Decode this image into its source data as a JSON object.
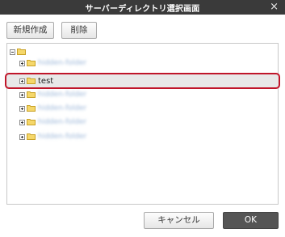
{
  "dialog": {
    "title": "サーバーディレクトリ選択画面",
    "close_glyph": "×"
  },
  "toolbar": {
    "new_label": "新規作成",
    "delete_label": "削除"
  },
  "tree": {
    "root_name": "",
    "items": [
      {
        "label": "hidden-folder",
        "blurred": true,
        "selected": false
      },
      {
        "label": "test",
        "blurred": false,
        "selected": true
      },
      {
        "label": "hidden-folder",
        "blurred": true,
        "selected": false
      },
      {
        "label": "hidden-folder",
        "blurred": true,
        "selected": false
      },
      {
        "label": "hidden-folder",
        "blurred": true,
        "selected": false
      },
      {
        "label": "hidden-folder",
        "blurred": true,
        "selected": false
      }
    ]
  },
  "footer": {
    "cancel_label": "キャンセル",
    "ok_label": "OK"
  },
  "colors": {
    "titlebar": "#3a3a3a",
    "selection_outline": "#c0162a",
    "folder_fill": "#f5d76a",
    "ok_button": "#555555"
  }
}
